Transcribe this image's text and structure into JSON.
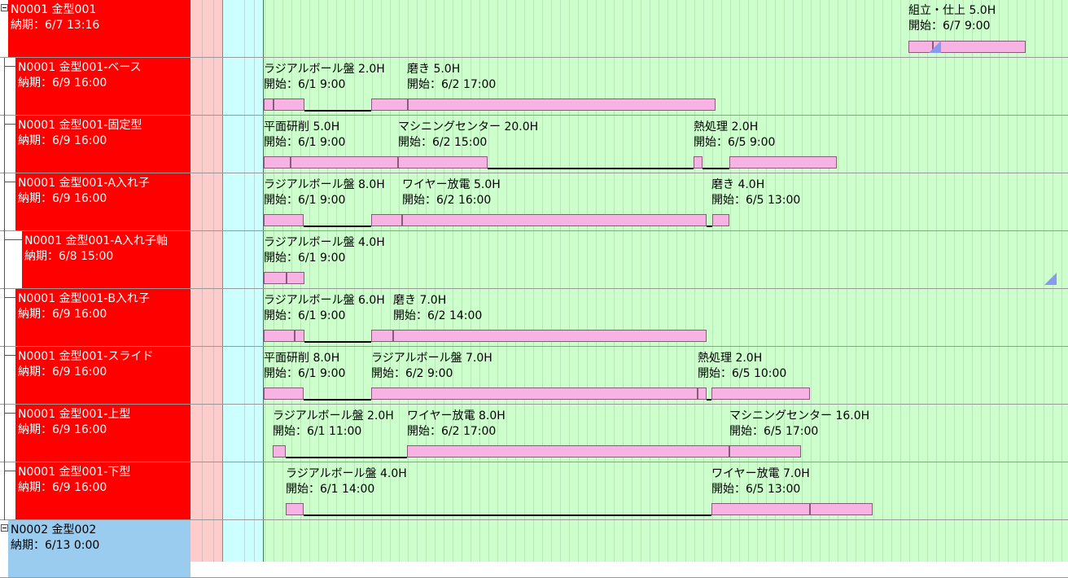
{
  "colors": {
    "row_bg": "#ccffcc",
    "name_parent_red": "#ff0000",
    "name_parent_blue": "#99ccee",
    "col_pink": "#ffcccc",
    "col_cyan": "#ccffff",
    "bar": "#f7b3e4",
    "marker": "#8899ee"
  },
  "icons": [
    "tree-collapse-box-icon",
    "triangle-marker-icon"
  ],
  "rows": [
    {
      "name": "N0001 金型001",
      "due": "納期：6/7 13:16",
      "type": "parent-red",
      "ops": [
        {
          "title": "組立・仕上 5.0H",
          "start": "開始：6/7 9:00"
        }
      ]
    },
    {
      "name": "N0001 金型001-ベース",
      "due": "納期：6/9 16:00",
      "type": "child",
      "ops": [
        {
          "title": "ラジアルボール盤 2.0H",
          "start": "開始：6/1 9:00"
        },
        {
          "title": "磨き 5.0H",
          "start": "開始：6/2 17:00"
        }
      ]
    },
    {
      "name": "N0001 金型001-固定型",
      "due": "納期：6/9 16:00",
      "type": "child",
      "ops": [
        {
          "title": "平面研削 5.0H",
          "start": "開始：6/1 9:00"
        },
        {
          "title": "マシニングセンター 20.0H",
          "start": "開始：6/2 15:00"
        },
        {
          "title": "熱処理 2.0H",
          "start": "開始：6/5 9:00"
        }
      ]
    },
    {
      "name": "N0001 金型001-A入れ子",
      "due": "納期：6/9 16:00",
      "type": "child",
      "ops": [
        {
          "title": "ラジアルボール盤 8.0H",
          "start": "開始：6/1 9:00"
        },
        {
          "title": "ワイヤー放電 5.0H",
          "start": "開始：6/2 16:00"
        },
        {
          "title": "磨き 4.0H",
          "start": "開始：6/5 13:00"
        }
      ]
    },
    {
      "name": "N0001 金型001-A入れ子軸",
      "due": "納期：6/8 15:00",
      "type": "grandchild",
      "ops": [
        {
          "title": "ラジアルボール盤 4.0H",
          "start": "開始：6/1 9:00"
        }
      ]
    },
    {
      "name": "N0001 金型001-B入れ子",
      "due": "納期：6/9 16:00",
      "type": "child",
      "ops": [
        {
          "title": "ラジアルボール盤 6.0H",
          "start": "開始：6/1 9:00"
        },
        {
          "title": "磨き 7.0H",
          "start": "開始：6/2 14:00"
        }
      ]
    },
    {
      "name": "N0001 金型001-スライド",
      "due": "納期：6/9 16:00",
      "type": "child",
      "ops": [
        {
          "title": "平面研削 8.0H",
          "start": "開始：6/1 9:00"
        },
        {
          "title": "ラジアルボール盤 7.0H",
          "start": "開始：6/2 9:00"
        },
        {
          "title": "熱処理 2.0H",
          "start": "開始：6/5 10:00"
        }
      ]
    },
    {
      "name": "N0001 金型001-上型",
      "due": "納期：6/9 16:00",
      "type": "child",
      "ops": [
        {
          "title": "ラジアルボール盤 2.0H",
          "start": "開始：6/1 11:00"
        },
        {
          "title": "ワイヤー放電 8.0H",
          "start": "開始：6/2 17:00"
        },
        {
          "title": "マシニングセンター 16.0H",
          "start": "開始：6/5 17:00"
        }
      ]
    },
    {
      "name": "N0001 金型001-下型",
      "due": "納期：6/9 16:00",
      "type": "child",
      "ops": [
        {
          "title": "ラジアルボール盤 4.0H",
          "start": "開始：6/1 14:00"
        },
        {
          "title": "ワイヤー放電 7.0H",
          "start": "開始：6/5 13:00"
        }
      ]
    },
    {
      "name": "N0002 金型002",
      "due": "納期：6/13 0:00",
      "type": "parent-blue",
      "ops": []
    }
  ]
}
